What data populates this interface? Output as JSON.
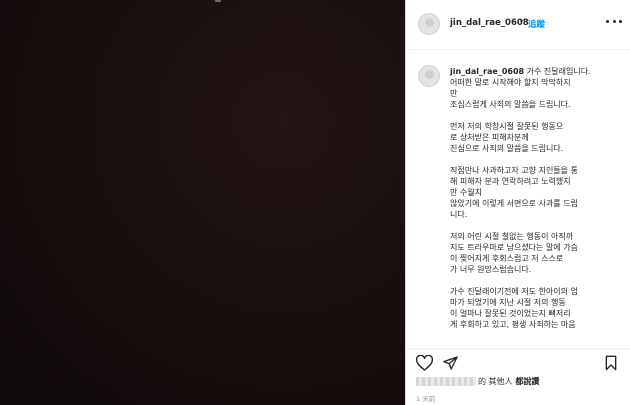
{
  "post": {
    "username": "jin_dal_rae_0608",
    "separator": "•",
    "follow_label": "追蹤",
    "caption_user": "jin_dal_rae_0608",
    "caption_text": " 가수 진달래입니다.\n어떠한 말로 시작해야 할지 막막하지\n만\n조심스럽게 사죄의 말씀을 드립니다.\n\n먼저 저의 학창시절 잘못된 행동으\n로 상처받은 피해자분께\n진심으로 사죄의 말씀을 드립니다.\n\n직접만나 사과하고자 고향 지인들을 통\n해 피해자 분과 연락하려고 노력했지\n만 수월치\n않았기에 이렇게 서면으로 사과를 드립\n니다.\n\n저의 어린 시절 철없는 행동이 아직까\n지도 트라우마로 남으셨다는 말에 가슴\n이 찢어지게 후회스럽고 저 스스로\n가 너무 원망스럽습니다.\n\n가수 진달래이기전에 저도 한아이의 엄\n마가 되었기에 지난 시절 저의 행동\n이 얼마나 잘못된 것이었는지 뼈저리\n게 후회하고 있고, 평생 사죄하는 마음",
    "likes_text": "的 其他人",
    "likes_suffix": " 都說讚",
    "timestamp": "1 天前"
  },
  "icons": {
    "more": "more-options-icon",
    "like": "heart-icon",
    "share": "paper-plane-icon",
    "save": "bookmark-icon",
    "avatar": "avatar-placeholder"
  },
  "colors": {
    "photo_bg": "#140c0c",
    "follow": "#0095f6",
    "text": "#262626",
    "muted": "#8e8e8e"
  }
}
